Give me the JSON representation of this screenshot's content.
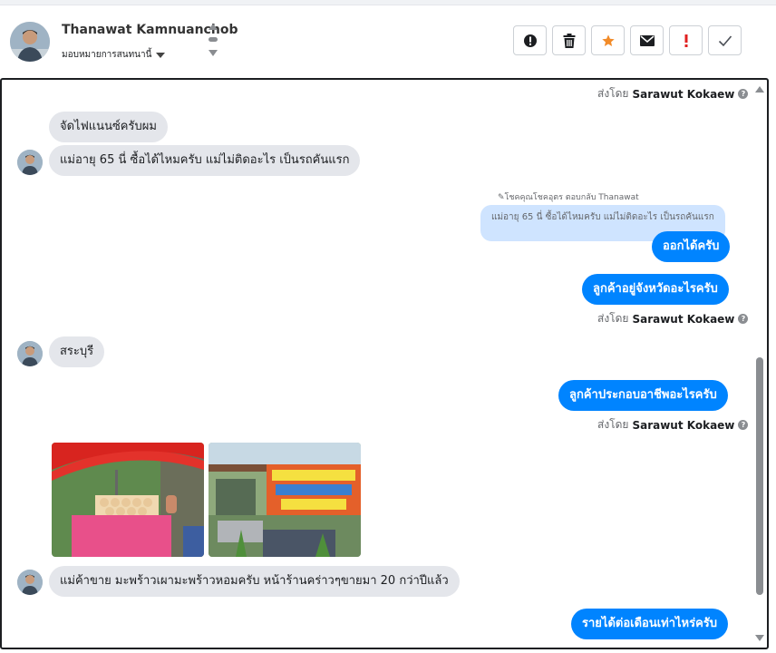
{
  "header": {
    "contact_name": "Thanawat Kamnuanchob",
    "assign_label": "มอบหมายการสนทนานี้",
    "actions": [
      {
        "name": "spam-icon",
        "label": "Mark as spam"
      },
      {
        "name": "trash-icon",
        "label": "Delete"
      },
      {
        "name": "star-icon",
        "label": "Star"
      },
      {
        "name": "envelope-icon",
        "label": "Mark as unread"
      },
      {
        "name": "exclamation-icon",
        "label": "Follow up"
      },
      {
        "name": "check-icon",
        "label": "Done"
      }
    ]
  },
  "colors": {
    "outgoing_bubble": "#0084ff",
    "incoming_bubble": "#e4e6eb",
    "quoted_bubble": "#cfe4ff",
    "star": "#f28b28",
    "follow_up": "#e02020"
  },
  "conversation": {
    "sent_by_prefix": "ส่งโดย",
    "agent_name": "Sarawut Kokaew",
    "reply_label": "โชคคุณโชคอุตร ตอบกลับ Thanawat",
    "messages": {
      "m1": "จัดไฟแนนซ์ครับผม",
      "m2": "แม่อายุ 65 นี่ ซื้อได้ไหมครับ แม่ไม่ติดอะไร เป็นรถคันแรก",
      "quoted": "แม่อายุ 65 นี่ ซื้อได้ไหมครับ แม่ไม่ติดอะไร เป็นรถคันแรก",
      "m3": "ออกได้ครับ",
      "m4": "ลูกค้าอยู่จังหวัดอะไรครับ",
      "m5": "สระบุรี",
      "m6": "ลูกค้าประกอบอาชีพอะไรครับ",
      "m7": "แม่ค้าขาย มะพร้าวเผามะพร้าวหอมครับ หน้าร้านคร่าวๆขายมา 20 กว่าปีแล้ว",
      "m8": "รายได้ต่อเดือนเท่าไหร่ครับ"
    },
    "photos": [
      {
        "name": "photo-coconut-stall",
        "content": "roadside stall with red umbrella selling coconuts"
      },
      {
        "name": "photo-shop-sign",
        "content": "shop front with orange sign"
      }
    ]
  }
}
